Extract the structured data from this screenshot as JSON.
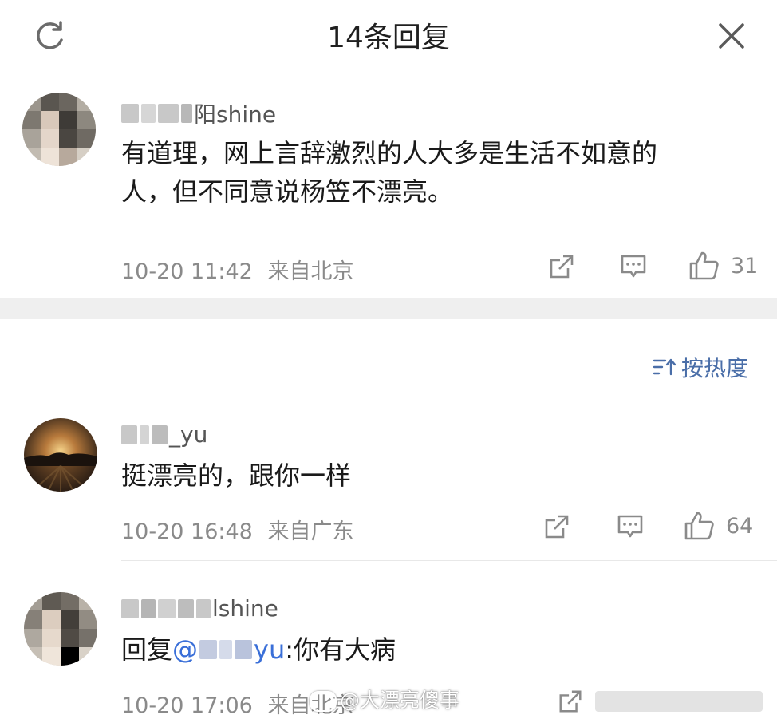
{
  "header": {
    "title": "14条回复",
    "refresh_icon": "refresh-icon",
    "close_icon": "close-icon"
  },
  "main_comment": {
    "username_visible": "阳shine",
    "text_line1": "有道理，网上言辞激烈的人大多是生活不如意的",
    "text_line2": "人，但不同意说杨笠不漂亮。",
    "time": "10-20 11:42",
    "location": "来自北京",
    "likes": "31"
  },
  "sort": {
    "label": "按热度",
    "icon": "sort-icon"
  },
  "replies": [
    {
      "username_visible": "_yu",
      "text": "挺漂亮的，跟你一样",
      "time": "10-20 16:48",
      "location": "来自广东",
      "likes": "64"
    },
    {
      "username_visible": "lshine",
      "reply_prefix": "回复",
      "mention_at": "@",
      "mention_name_visible": "yu",
      "reply_text": ":你有大病",
      "time": "10-20 17:06",
      "location": "来自北京"
    }
  ],
  "watermark": "@大漂亮傻事",
  "colors": {
    "accent_blue": "#4a6ea8",
    "mention_blue": "#3a6fd8",
    "meta_gray": "#8a8a8a",
    "band_gray": "#efefef"
  }
}
